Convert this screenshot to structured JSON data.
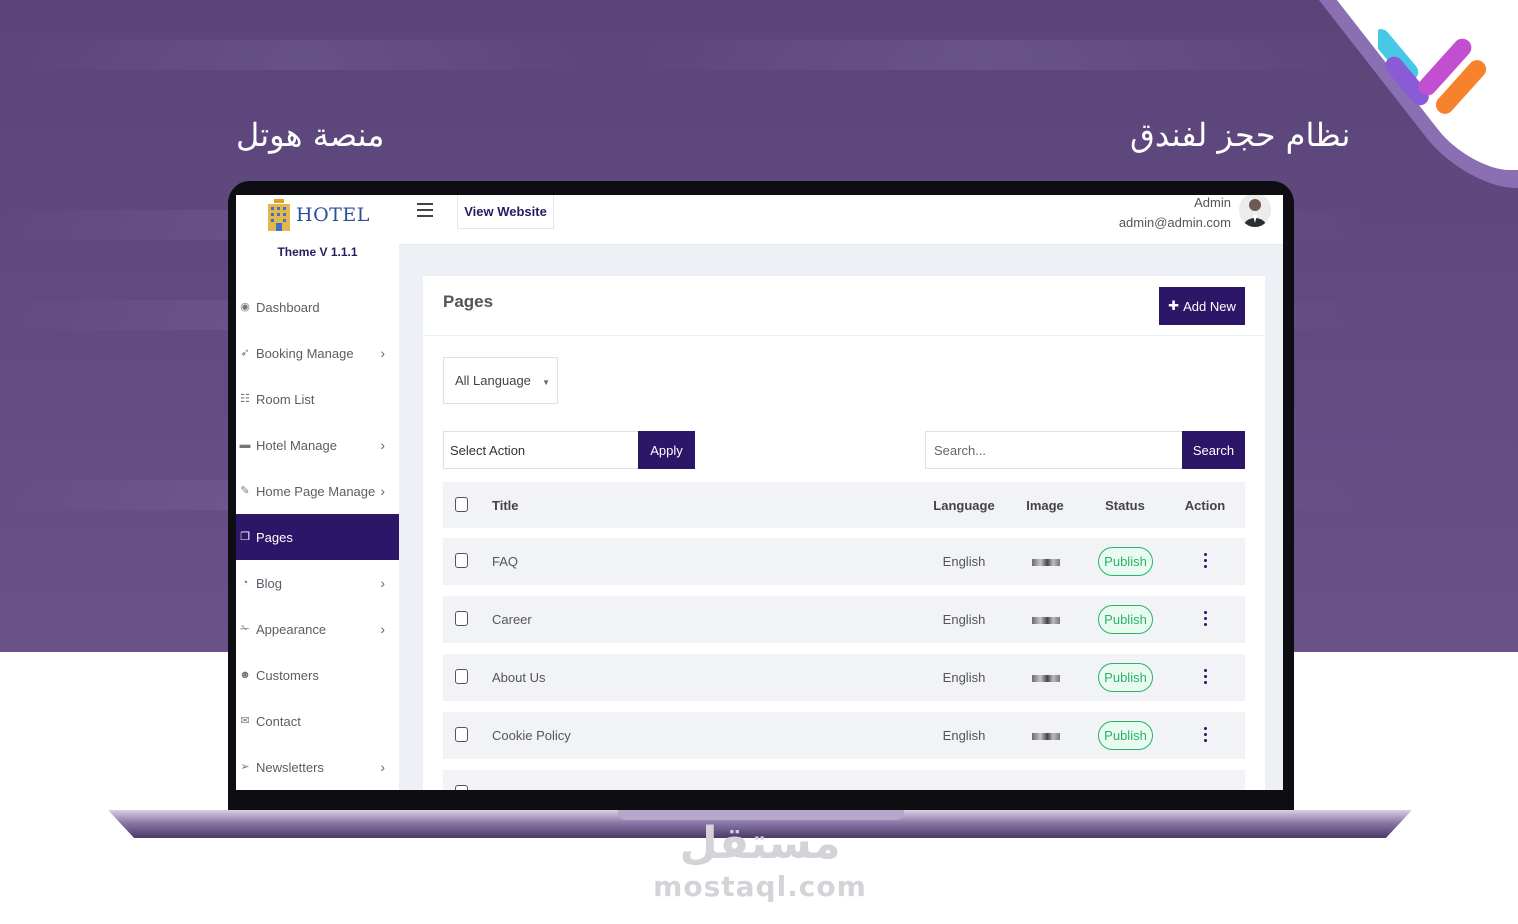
{
  "captions": {
    "left": "منصة هوتل",
    "right": "نظام حجز لفندق"
  },
  "watermark": {
    "arabic": "مستقل",
    "latin": "mostaql.com"
  },
  "colors": {
    "primary": "#2b1668",
    "background": "#5a4478",
    "status_green": "#29b36a"
  },
  "sidebar": {
    "brand": "HOTEL",
    "theme_version": "Theme V 1.1.1",
    "items": [
      {
        "label": "Dashboard",
        "icon": "dashboard-icon",
        "has_submenu": false,
        "active": false
      },
      {
        "label": "Booking Manage",
        "icon": "rocket-icon",
        "has_submenu": true,
        "active": false
      },
      {
        "label": "Room List",
        "icon": "list-icon",
        "has_submenu": false,
        "active": false
      },
      {
        "label": "Hotel Manage",
        "icon": "bed-icon",
        "has_submenu": true,
        "active": false
      },
      {
        "label": "Home Page Manage",
        "icon": "edit-icon",
        "has_submenu": true,
        "active": false
      },
      {
        "label": "Pages",
        "icon": "copy-icon",
        "has_submenu": false,
        "active": true
      },
      {
        "label": "Blog",
        "icon": "rss-icon",
        "has_submenu": true,
        "active": false
      },
      {
        "label": "Appearance",
        "icon": "wrench-icon",
        "has_submenu": true,
        "active": false
      },
      {
        "label": "Customers",
        "icon": "users-icon",
        "has_submenu": false,
        "active": false
      },
      {
        "label": "Contact",
        "icon": "envelope-icon",
        "has_submenu": false,
        "active": false
      },
      {
        "label": "Newsletters",
        "icon": "send-icon",
        "has_submenu": true,
        "active": false
      }
    ]
  },
  "header": {
    "view_website": "View Website",
    "admin_name": "Admin",
    "admin_email": "admin@admin.com"
  },
  "panel": {
    "title": "Pages",
    "add_new": "Add New",
    "language_filter": "All Language",
    "bulk_action": "Select Action",
    "apply": "Apply",
    "search_placeholder": "Search...",
    "search_button": "Search"
  },
  "table": {
    "columns": [
      "Title",
      "Language",
      "Image",
      "Status",
      "Action"
    ],
    "rows": [
      {
        "title": "FAQ",
        "language": "English",
        "status": "Publish"
      },
      {
        "title": "Career",
        "language": "English",
        "status": "Publish"
      },
      {
        "title": "About Us",
        "language": "English",
        "status": "Publish"
      },
      {
        "title": "Cookie Policy",
        "language": "English",
        "status": "Publish"
      }
    ]
  }
}
